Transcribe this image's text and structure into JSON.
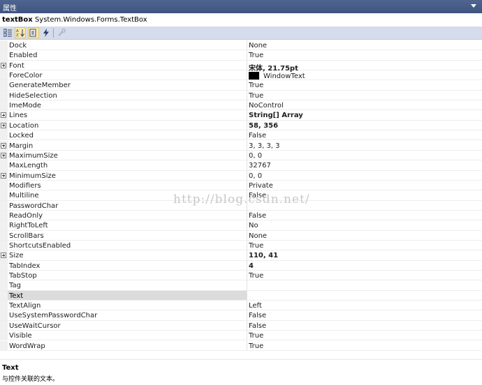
{
  "window": {
    "title": "属性"
  },
  "object": {
    "name": "textBox",
    "type": "System.Windows.Forms.TextBox"
  },
  "toolbar": {
    "buttons": [
      {
        "name": "categorized-button",
        "icon": "categorized-icon",
        "checked": false
      },
      {
        "name": "alphabetical-button",
        "icon": "alphabetical-sort-icon",
        "checked": true
      },
      {
        "name": "properties-button",
        "icon": "properties-page-icon",
        "checked": true
      },
      {
        "name": "events-button",
        "icon": "lightning-bolt-icon",
        "checked": false
      },
      {
        "name": "property-pages-button",
        "icon": "wrench-icon",
        "checked": false
      }
    ]
  },
  "properties": [
    {
      "name": "Dock",
      "value": "None",
      "expandable": false,
      "bold": false
    },
    {
      "name": "Enabled",
      "value": "True",
      "expandable": false,
      "bold": false
    },
    {
      "name": "Font",
      "value": "宋体, 21.75pt",
      "expandable": true,
      "bold": true
    },
    {
      "name": "ForeColor",
      "value": "WindowText",
      "expandable": false,
      "bold": false,
      "swatch": "#000000"
    },
    {
      "name": "GenerateMember",
      "value": "True",
      "expandable": false,
      "bold": false
    },
    {
      "name": "HideSelection",
      "value": "True",
      "expandable": false,
      "bold": false
    },
    {
      "name": "ImeMode",
      "value": "NoControl",
      "expandable": false,
      "bold": false
    },
    {
      "name": "Lines",
      "value": "String[] Array",
      "expandable": true,
      "bold": true
    },
    {
      "name": "Location",
      "value": "58, 356",
      "expandable": true,
      "bold": true
    },
    {
      "name": "Locked",
      "value": "False",
      "expandable": false,
      "bold": false
    },
    {
      "name": "Margin",
      "value": "3, 3, 3, 3",
      "expandable": true,
      "bold": false
    },
    {
      "name": "MaximumSize",
      "value": "0, 0",
      "expandable": true,
      "bold": false
    },
    {
      "name": "MaxLength",
      "value": "32767",
      "expandable": false,
      "bold": false
    },
    {
      "name": "MinimumSize",
      "value": "0, 0",
      "expandable": true,
      "bold": false
    },
    {
      "name": "Modifiers",
      "value": "Private",
      "expandable": false,
      "bold": false
    },
    {
      "name": "Multiline",
      "value": "False",
      "expandable": false,
      "bold": false
    },
    {
      "name": "PasswordChar",
      "value": "",
      "expandable": false,
      "bold": false
    },
    {
      "name": "ReadOnly",
      "value": "False",
      "expandable": false,
      "bold": false
    },
    {
      "name": "RightToLeft",
      "value": "No",
      "expandable": false,
      "bold": false
    },
    {
      "name": "ScrollBars",
      "value": "None",
      "expandable": false,
      "bold": false
    },
    {
      "name": "ShortcutsEnabled",
      "value": "True",
      "expandable": false,
      "bold": false
    },
    {
      "name": "Size",
      "value": "110, 41",
      "expandable": true,
      "bold": true
    },
    {
      "name": "TabIndex",
      "value": "4",
      "expandable": false,
      "bold": true
    },
    {
      "name": "TabStop",
      "value": "True",
      "expandable": false,
      "bold": false
    },
    {
      "name": "Tag",
      "value": "",
      "expandable": false,
      "bold": false
    },
    {
      "name": "Text",
      "value": "",
      "expandable": false,
      "bold": false,
      "selected": true
    },
    {
      "name": "TextAlign",
      "value": "Left",
      "expandable": false,
      "bold": false
    },
    {
      "name": "UseSystemPasswordChar",
      "value": "False",
      "expandable": false,
      "bold": false
    },
    {
      "name": "UseWaitCursor",
      "value": "False",
      "expandable": false,
      "bold": false
    },
    {
      "name": "Visible",
      "value": "True",
      "expandable": false,
      "bold": false
    },
    {
      "name": "WordWrap",
      "value": "True",
      "expandable": false,
      "bold": false
    }
  ],
  "watermark": "http://blog.csdn.net/",
  "description": {
    "title": "Text",
    "text": "与控件关联的文本。"
  }
}
